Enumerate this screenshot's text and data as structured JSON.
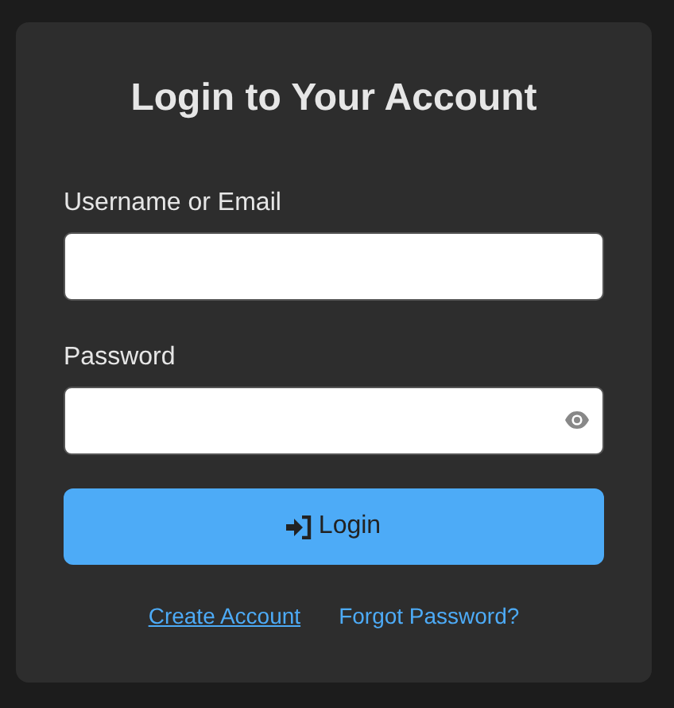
{
  "title": "Login to Your Account",
  "fields": [
    {
      "label": "Username or Email",
      "reveal_icon": false
    },
    {
      "label": "Password",
      "reveal_icon": true
    }
  ],
  "submit_button": {
    "label": "Login"
  },
  "links": [
    {
      "label": "Create Account",
      "underlined": true
    },
    {
      "label": "Forgot Password?",
      "underlined": false
    }
  ]
}
